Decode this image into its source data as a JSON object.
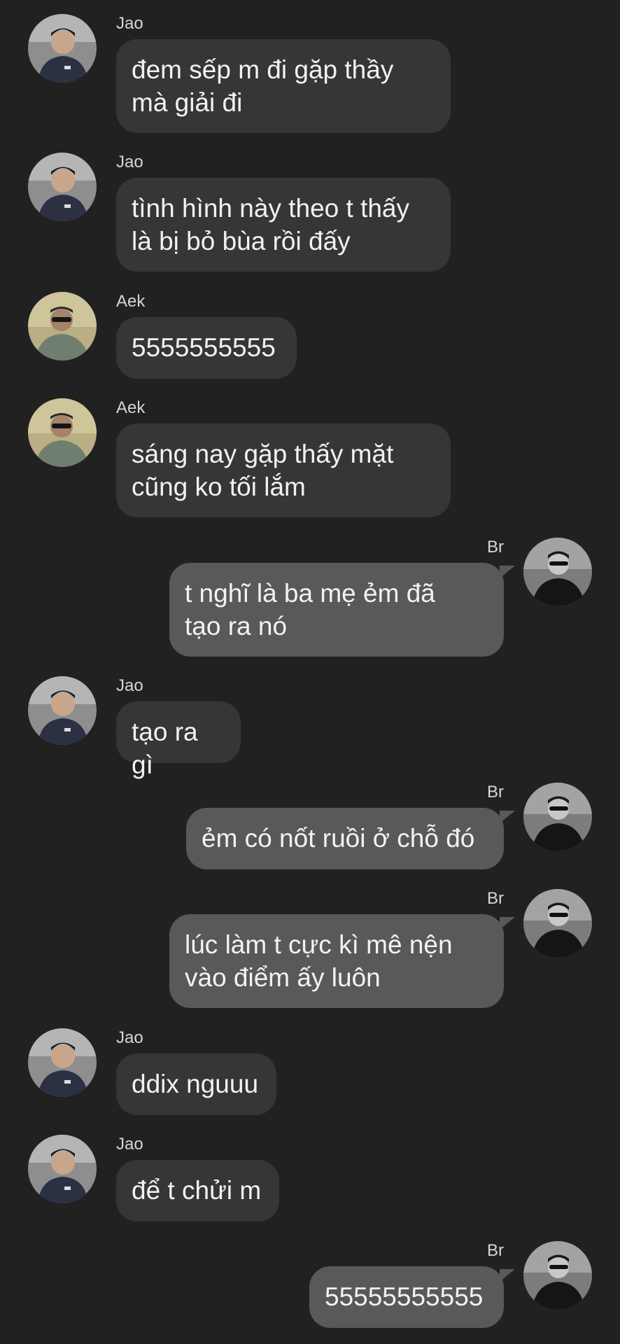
{
  "messages": [
    {
      "side": "in",
      "sender": "Jao",
      "avatar": "jao-avatar",
      "text": "đem sếp m đi gặp thầy\nmà giải đi"
    },
    {
      "side": "in",
      "sender": "Jao",
      "avatar": "jao-avatar",
      "text": "tình hình này theo t thấy\nlà bị bỏ bùa rồi đấy"
    },
    {
      "side": "in",
      "sender": "Aek",
      "avatar": "aek-avatar",
      "text": "5555555555"
    },
    {
      "side": "in",
      "sender": "Aek",
      "avatar": "aek-avatar",
      "text": "sáng nay gặp thấy mặt\ncũng ko tối lắm"
    },
    {
      "side": "out",
      "sender": "Br",
      "avatar": "br-avatar",
      "text": "t nghĩ là ba mẹ ẻm đã\ntạo ra nó"
    },
    {
      "side": "in",
      "sender": "Jao",
      "avatar": "jao-avatar",
      "text": "tạo ra gì"
    },
    {
      "side": "out",
      "sender": "Br",
      "avatar": "br-avatar",
      "text": "ẻm có nốt ruồi ở chỗ đó"
    },
    {
      "side": "out",
      "sender": "Br",
      "avatar": "br-avatar",
      "text": "lúc làm t cực kì mê nện\nvào điểm ấy luôn"
    },
    {
      "side": "in",
      "sender": "Jao",
      "avatar": "jao-avatar",
      "text": "ddix nguuu"
    },
    {
      "side": "in",
      "sender": "Jao",
      "avatar": "jao-avatar",
      "text": "để t chửi m"
    },
    {
      "side": "out",
      "sender": "Br",
      "avatar": "br-avatar",
      "text": "55555555555"
    }
  ],
  "colors": {
    "background": "#212121",
    "incoming_bubble": "#363636",
    "outgoing_bubble": "#595959",
    "text": "#f2f2f2",
    "name": "#d6d6d6"
  }
}
